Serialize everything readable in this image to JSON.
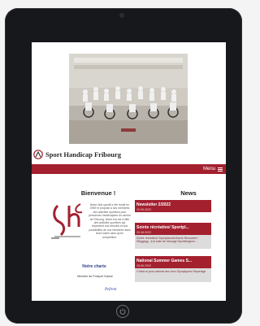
{
  "site": {
    "name": "Sport Handicap Fribourg",
    "menu_label": "Menu"
  },
  "welcome": {
    "heading": "Bienvenue !",
    "intro": "Notre club sportif a été fondé en 1969 et propose à ses membres des activités sportives pour personnes handicapées du canton de Fribourg. Notre but est d'offrir des activités sportives qui répondent aux besoins et aux possibilités de nos membres dans leurs loisirs ainsi qu'en compétition.",
    "charter_link": "Notre charte",
    "member_text": "Membre de Portport Suisse",
    "signature": "Pefrent"
  },
  "news": {
    "heading": "News",
    "items": [
      {
        "title": "Newsletter 2/2022",
        "date": "10.09.2022",
        "excerpt": ""
      },
      {
        "title": "Soirée récréative/ Sportpl...",
        "date": "30.08.2022",
        "excerpt": "Soirée récréative/ Sportplausch/Avenir Rencontre / Weggegg - à la suite de l'Ansage Sportbringtorn..."
      },
      {
        "title": "National Summer Games S...",
        "date": "15.06.2022",
        "excerpt": "C'était un jeux national des Jeux Olympiques! Reportage"
      }
    ]
  },
  "colors": {
    "brand_red": "#a3202f",
    "link_blue": "#2e3f8f"
  },
  "icons": {
    "menu": "hamburger-icon",
    "home": "home-button-icon"
  }
}
